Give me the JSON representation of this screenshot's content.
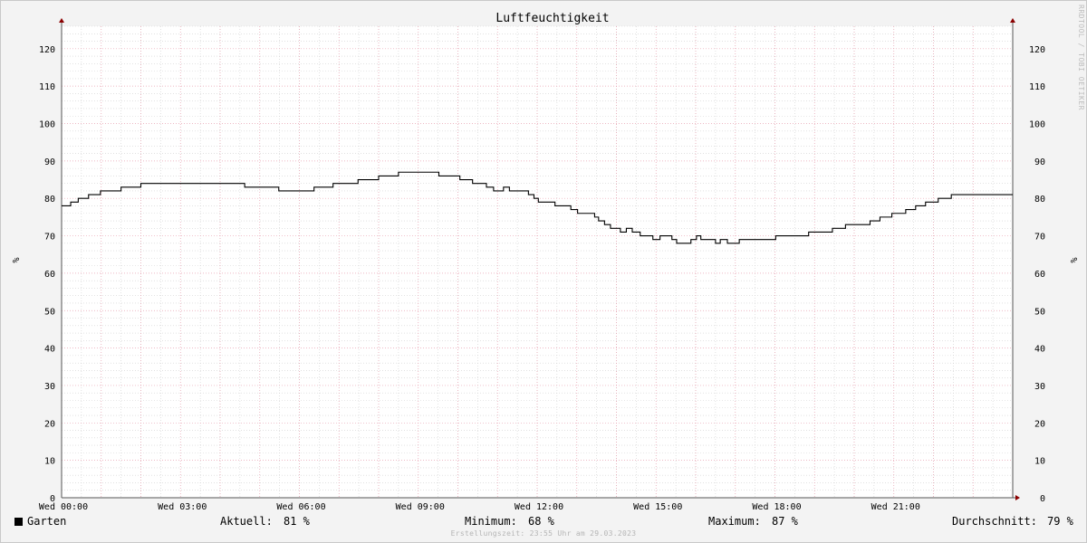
{
  "credit": "RRDTOOL / TOBI OETIKER",
  "legend": {
    "series_name": "Garten",
    "current_label": "Aktuell:",
    "current_value": "81 %",
    "min_label": "Minimum:",
    "min_value": "68 %",
    "max_label": "Maximum:",
    "max_value": "87 %",
    "avg_label": "Durchschnitt:",
    "avg_value": "79 %"
  },
  "footer": "Erstellungszeit: 23:55 Uhr am 29.03.2023",
  "colors": {
    "plot_bg": "#ffffff",
    "major_grid": "#e8a0b0",
    "minor_grid": "#d0d0d0",
    "line": "#000000",
    "axis": "#555555",
    "arrow": "#8b0000"
  },
  "chart_data": {
    "type": "line",
    "title": "Luftfeuchtigkeit",
    "ylabel": "%",
    "ylabel_right": "%",
    "ylim": [
      0,
      126
    ],
    "yticks": [
      0,
      10,
      20,
      30,
      40,
      50,
      60,
      70,
      80,
      90,
      100,
      110,
      120
    ],
    "xlim": [
      0,
      24
    ],
    "xticks": [
      {
        "x": 0,
        "label": "Wed 00:00"
      },
      {
        "x": 3,
        "label": "Wed 03:00"
      },
      {
        "x": 6,
        "label": "Wed 06:00"
      },
      {
        "x": 9,
        "label": "Wed 09:00"
      },
      {
        "x": 12,
        "label": "Wed 12:00"
      },
      {
        "x": 15,
        "label": "Wed 15:00"
      },
      {
        "x": 18,
        "label": "Wed 18:00"
      },
      {
        "x": 21,
        "label": "Wed 21:00"
      }
    ],
    "grid": true,
    "legend_position": "bottom",
    "series": [
      {
        "name": "Garten",
        "step": true,
        "points": [
          [
            0.0,
            78
          ],
          [
            0.23,
            79
          ],
          [
            0.42,
            80
          ],
          [
            0.68,
            81
          ],
          [
            0.98,
            82
          ],
          [
            1.5,
            83
          ],
          [
            2.0,
            84
          ],
          [
            4.62,
            83
          ],
          [
            5.48,
            82
          ],
          [
            6.37,
            83
          ],
          [
            6.85,
            84
          ],
          [
            7.48,
            85
          ],
          [
            8.0,
            86
          ],
          [
            8.5,
            87
          ],
          [
            9.52,
            86
          ],
          [
            10.05,
            85
          ],
          [
            10.37,
            84
          ],
          [
            10.72,
            83
          ],
          [
            10.9,
            82
          ],
          [
            11.15,
            83
          ],
          [
            11.3,
            82
          ],
          [
            11.78,
            81
          ],
          [
            11.92,
            80
          ],
          [
            12.03,
            79
          ],
          [
            12.45,
            78
          ],
          [
            12.85,
            77
          ],
          [
            13.02,
            76
          ],
          [
            13.45,
            75
          ],
          [
            13.55,
            74
          ],
          [
            13.7,
            73
          ],
          [
            13.85,
            72
          ],
          [
            14.1,
            71
          ],
          [
            14.25,
            72
          ],
          [
            14.4,
            71
          ],
          [
            14.6,
            70
          ],
          [
            14.92,
            69
          ],
          [
            15.1,
            70
          ],
          [
            15.4,
            69
          ],
          [
            15.52,
            68
          ],
          [
            15.88,
            69
          ],
          [
            16.02,
            70
          ],
          [
            16.13,
            69
          ],
          [
            16.5,
            68
          ],
          [
            16.62,
            69
          ],
          [
            16.8,
            68
          ],
          [
            17.1,
            69
          ],
          [
            18.02,
            70
          ],
          [
            18.85,
            71
          ],
          [
            19.45,
            72
          ],
          [
            19.78,
            73
          ],
          [
            20.4,
            74
          ],
          [
            20.65,
            75
          ],
          [
            20.95,
            76
          ],
          [
            21.3,
            77
          ],
          [
            21.55,
            78
          ],
          [
            21.8,
            79
          ],
          [
            22.12,
            80
          ],
          [
            22.45,
            81
          ],
          [
            24.0,
            81
          ]
        ]
      }
    ]
  }
}
